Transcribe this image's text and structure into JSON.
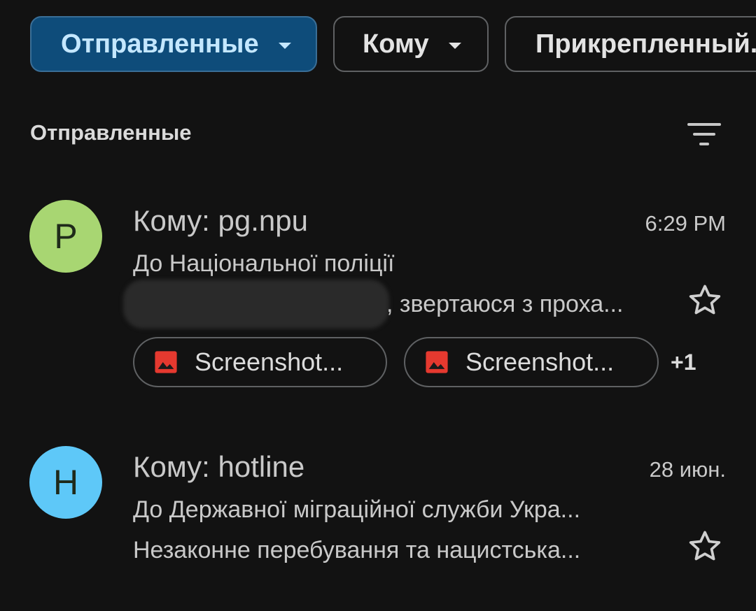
{
  "filters": {
    "sent_label": "Отправленные",
    "to_label": "Кому",
    "attachment_label": "Прикрепленный..."
  },
  "section": {
    "title": "Отправленные"
  },
  "emails": [
    {
      "avatar_letter": "P",
      "avatar_color": "#a8d672",
      "recipient": "Кому: pg.npu",
      "time": "6:29 PM",
      "subject": "До Національної поліції",
      "snippet": ", звертаюся з проха...",
      "attachments": [
        "Screenshot...",
        "Screenshot..."
      ],
      "more_count": "+1"
    },
    {
      "avatar_letter": "H",
      "avatar_color": "#5ec8f8",
      "recipient": "Кому: hotline",
      "time": "28 июн.",
      "subject": "До Державної міграційної служби Укра...",
      "snippet": "Незаконне перебування та нацистська..."
    }
  ],
  "icons": {
    "filter": "filter-list-icon",
    "star": "star-outline-icon",
    "image": "image-file-icon",
    "dropdown": "arrow-drop-down-icon"
  },
  "colors": {
    "background": "#121212",
    "chip_active_bg": "#0e4c7a",
    "chip_active_text": "#c4e7ff",
    "image_icon_red": "#e5392f"
  }
}
